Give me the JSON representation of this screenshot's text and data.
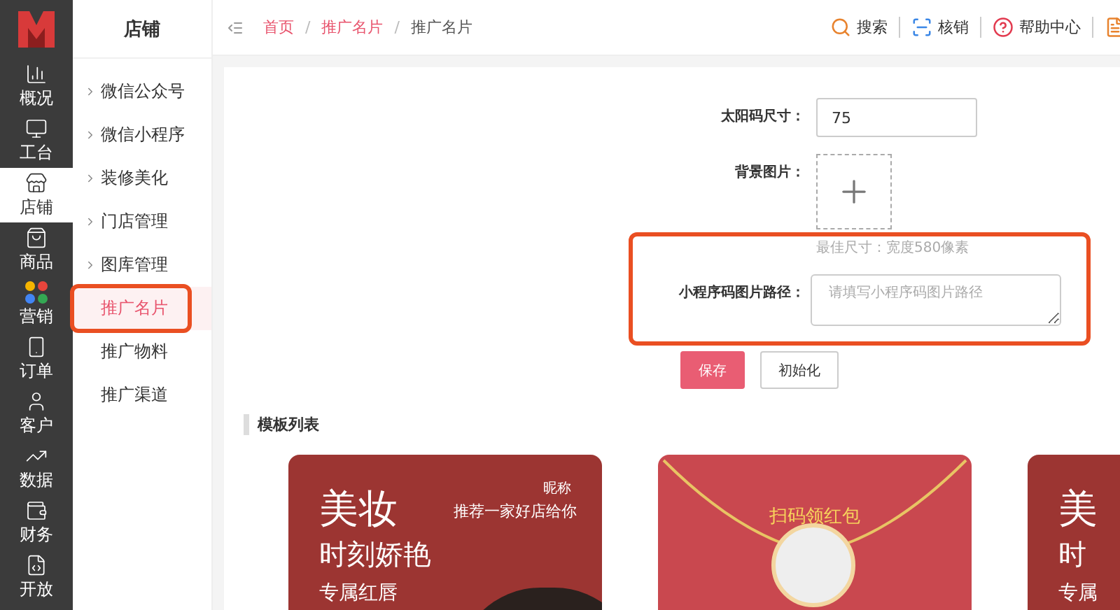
{
  "rail": {
    "items": [
      {
        "label": "概况",
        "selected": false
      },
      {
        "label": "工台",
        "selected": false
      },
      {
        "label": "店铺",
        "selected": true
      },
      {
        "label": "商品",
        "selected": false
      },
      {
        "label": "营销",
        "selected": false
      },
      {
        "label": "订单",
        "selected": false
      },
      {
        "label": "客户",
        "selected": false
      },
      {
        "label": "数据",
        "selected": false
      },
      {
        "label": "财务",
        "selected": false
      },
      {
        "label": "开放",
        "selected": false
      }
    ]
  },
  "submenu": {
    "title": "店铺",
    "items": [
      {
        "label": "微信公众号",
        "expandable": true,
        "selected": false,
        "highlighted": false
      },
      {
        "label": "微信小程序",
        "expandable": true,
        "selected": false,
        "highlighted": false
      },
      {
        "label": "装修美化",
        "expandable": true,
        "selected": false,
        "highlighted": false
      },
      {
        "label": "门店管理",
        "expandable": true,
        "selected": false,
        "highlighted": false
      },
      {
        "label": "图库管理",
        "expandable": true,
        "selected": false,
        "highlighted": false
      },
      {
        "label": "推广名片",
        "expandable": false,
        "selected": true,
        "highlighted": true
      },
      {
        "label": "推广物料",
        "expandable": false,
        "selected": false,
        "highlighted": false
      },
      {
        "label": "推广渠道",
        "expandable": false,
        "selected": false,
        "highlighted": false
      }
    ]
  },
  "topbar": {
    "separator": "/",
    "breadcrumb": [
      {
        "label": "首页",
        "link": true
      },
      {
        "label": "推广名片",
        "link": true
      },
      {
        "label": "推广名片",
        "link": false
      }
    ],
    "actions": [
      {
        "label": "搜索"
      },
      {
        "label": "核销"
      },
      {
        "label": "帮助中心"
      }
    ]
  },
  "form": {
    "fields": [
      {
        "kind": "input",
        "label": "太阳码尺寸：",
        "value": "75",
        "highlighted": false
      },
      {
        "kind": "upload",
        "label": "背景图片：",
        "hint": "最佳尺寸：宽度580像素",
        "highlighted": false
      },
      {
        "kind": "textarea",
        "label": "小程序码图片路径：",
        "placeholder": "请填写小程序码图片路径",
        "highlighted": true
      }
    ],
    "buttons": [
      {
        "label": "保存",
        "primary": true
      },
      {
        "label": "初始化",
        "primary": false
      }
    ]
  },
  "templates": {
    "title": "模板列表",
    "cards": [
      {
        "kind": "portrait",
        "headline": "美妆",
        "subline": "时刻娇艳",
        "tagline": "专属红唇",
        "nickname": "昵称",
        "slogan": "推荐一家好店给你"
      },
      {
        "kind": "envelope",
        "caption": "扫码领红包"
      },
      {
        "kind": "portrait",
        "headline": "美",
        "subline": "时",
        "tagline": "专属"
      }
    ]
  }
}
